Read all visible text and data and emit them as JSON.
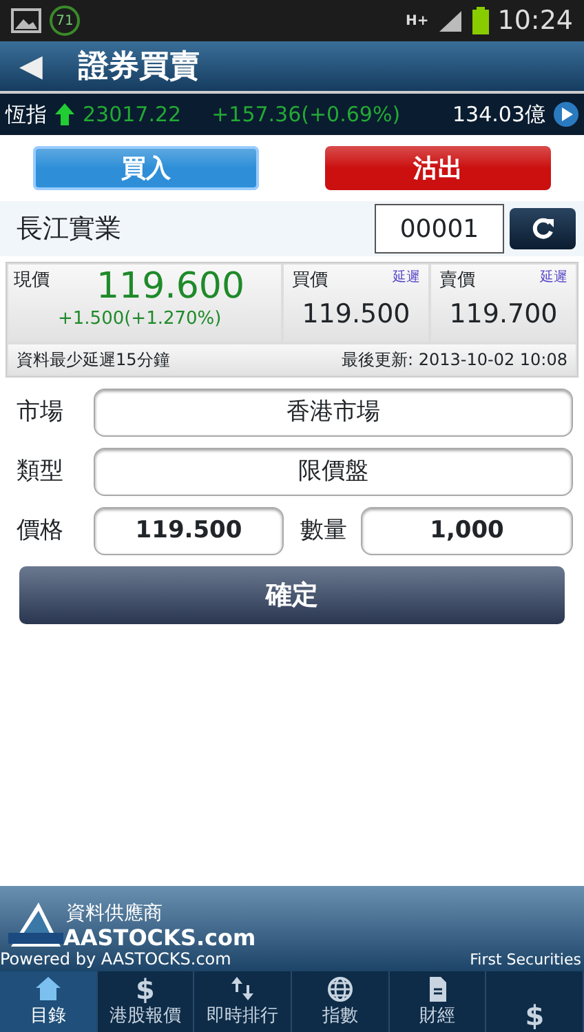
{
  "status_bar": {
    "badge": "71",
    "network": "H+",
    "time": "10:24"
  },
  "title_bar": {
    "back": "◀",
    "title": "證券買賣"
  },
  "ticker": {
    "index_name": "恆指",
    "rising": true,
    "value": "23017.22",
    "change": "+157.36(+0.69%)",
    "turnover": "134.03億"
  },
  "trade_tabs": [
    {
      "label": "買入",
      "selected": true,
      "color": "#2e8fd8"
    },
    {
      "label": "沽出",
      "selected": false,
      "color": "#cc1010"
    }
  ],
  "stock": {
    "name": "長江實業",
    "code": "00001"
  },
  "quote": {
    "last_label": "現價",
    "last": "119.600",
    "last_change": "+1.500(+1.270%)",
    "bid_label": "買價",
    "bid_tag": "延遲",
    "bid": "119.500",
    "ask_label": "賣價",
    "ask_tag": "延遲",
    "ask": "119.700",
    "delay_note": "資料最少延遲15分鐘",
    "updated": "最後更新: 2013-10-02 10:08"
  },
  "form": {
    "market_label": "市場",
    "market": "香港市場",
    "type_label": "類型",
    "type": "限價盤",
    "price_label": "價格",
    "price": "119.500",
    "qty_label": "數量",
    "qty": "1,000"
  },
  "confirm": "確定",
  "footer": {
    "provider": "資料供應商",
    "brand": "AASTOCKS.com",
    "powered": "Powered by AASTOCKS.com",
    "broker": "First Securities"
  },
  "nav_tabs": [
    {
      "kind": "home",
      "label": "目錄",
      "selected": true
    },
    {
      "kind": "dollar",
      "glyph": "$",
      "label": "港股報價",
      "selected": false
    },
    {
      "kind": "updown",
      "label": "即時排行",
      "selected": false
    },
    {
      "kind": "globe",
      "label": "指數",
      "selected": false
    },
    {
      "kind": "document",
      "label": "財經",
      "selected": false
    },
    {
      "kind": "dollar",
      "glyph": "$",
      "selected": false
    }
  ]
}
